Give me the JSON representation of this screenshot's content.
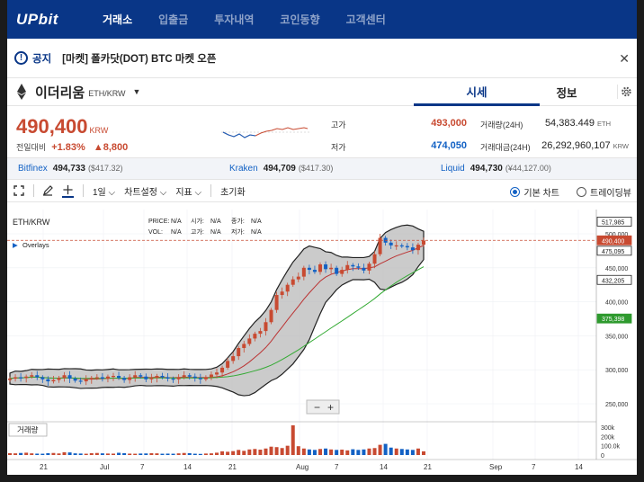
{
  "nav": {
    "logo": "UPbit",
    "items": [
      "거래소",
      "입출금",
      "투자내역",
      "코인동향",
      "고객센터"
    ]
  },
  "notice": {
    "icon": "!",
    "tag": "공지",
    "text": "[마켓] 폴카닷(DOT) BTC 마켓 오픈",
    "close": "✕"
  },
  "coin": {
    "name": "이더리움",
    "pair": "ETH/KRW",
    "caret": "▼",
    "tabs": [
      "시세",
      "정보"
    ]
  },
  "price": {
    "current": "490,400",
    "unit": "KRW",
    "change_label": "전일대비",
    "change_pct": "+1.83%",
    "change_amt": "▲8,800",
    "high_label": "고가",
    "high": "493,000",
    "low_label": "저가",
    "low": "474,050",
    "volume_label": "거래량(24H)",
    "volume": "54,383.449",
    "volume_unit": "ETH",
    "amount_label": "거래대금(24H)",
    "amount": "26,292,960,107",
    "amount_unit": "KRW"
  },
  "exchanges": [
    {
      "name": "Bitfinex",
      "price": "494,733",
      "sub": "($417.32)"
    },
    {
      "name": "Kraken",
      "price": "494,709",
      "sub": "($417.30)"
    },
    {
      "name": "Liquid",
      "price": "494,730",
      "sub": "(¥44,127.00)"
    }
  ],
  "toolbar": {
    "interval": "1일",
    "chart_settings": "차트설정",
    "indicators": "지표",
    "reset": "초기화",
    "basic_chart": "기본 차트",
    "tradingview": "트레이딩뷰"
  },
  "chart_info": {
    "symbol": "ETH/KRW",
    "overlays": "Overlays",
    "volume_tab": "거래량",
    "price_label": "PRICE:",
    "price_val": "N/A",
    "vol_label": "VOL:",
    "vol_val": "N/A",
    "open_label": "시가:",
    "open_val": "N/A",
    "high_label": "고가:",
    "high_val": "N/A",
    "close_label": "종가:",
    "close_val": "N/A",
    "low_label": "저가:",
    "low_val": "N/A",
    "zoom_out": "−",
    "zoom_in": "+"
  },
  "colors": {
    "brand": "#093687",
    "up": "#c84a31",
    "down": "#1261c4"
  },
  "chart_data": {
    "type": "candlestick",
    "y_ticks": [
      "500,000",
      "450,000",
      "400,000",
      "350,000",
      "300,000",
      "250,000"
    ],
    "price_tags": [
      {
        "label": "517,985",
        "value": 517985,
        "color": "#222222"
      },
      {
        "label": "490,400",
        "value": 490400,
        "color": "#c84a31"
      },
      {
        "label": "475,095",
        "value": 475095,
        "color": "#222222"
      },
      {
        "label": "432,205",
        "value": 432205,
        "color": "#222222"
      },
      {
        "label": "375,398",
        "value": 375398,
        "color": "#2e9a2e"
      }
    ],
    "volume_ticks": [
      "300k",
      "200k",
      "100.0k",
      "0"
    ],
    "x_ticks": [
      "21",
      "Jul",
      "7",
      "14",
      "21",
      "Aug",
      "7",
      "14",
      "21",
      "Sep",
      "7",
      "14"
    ],
    "ylim": [
      220000,
      530000
    ],
    "closes": [
      287,
      289,
      288,
      290,
      292,
      289,
      286,
      283,
      285,
      288,
      292,
      287,
      284,
      283,
      286,
      288,
      289,
      287,
      290,
      291,
      288,
      285,
      289,
      292,
      290,
      286,
      288,
      291,
      289,
      287,
      286,
      289,
      292,
      290,
      288,
      286,
      289,
      293,
      296,
      303,
      313,
      320,
      332,
      338,
      346,
      353,
      357,
      370,
      388,
      410,
      415,
      425,
      433,
      437,
      450,
      447,
      444,
      455,
      448,
      450,
      441,
      447,
      454,
      452,
      450,
      446,
      456,
      470,
      494,
      487,
      483,
      483,
      482,
      480,
      476,
      484,
      490
    ],
    "volumes": [
      20,
      18,
      22,
      25,
      18,
      15,
      14,
      20,
      22,
      17,
      30,
      28,
      18,
      16,
      14,
      20,
      22,
      18,
      16,
      15,
      24,
      20,
      15,
      14,
      16,
      17,
      20,
      18,
      14,
      15,
      14,
      18,
      22,
      20,
      14,
      12,
      16,
      18,
      25,
      40,
      35,
      42,
      55,
      45,
      60,
      65,
      58,
      70,
      90,
      85,
      75,
      100,
      320,
      95,
      70,
      60,
      55,
      65,
      70,
      60,
      55,
      58,
      50,
      62,
      55,
      60,
      70,
      75,
      110,
      120,
      80,
      70,
      65,
      60,
      55,
      70,
      40
    ]
  }
}
